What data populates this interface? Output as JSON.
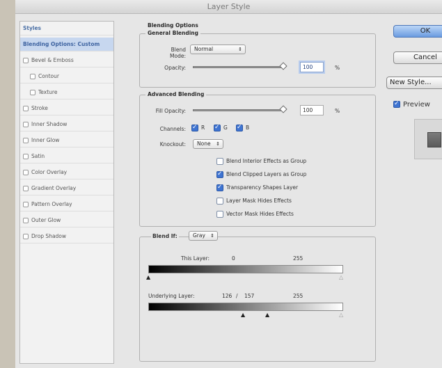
{
  "window": {
    "title": "Layer Style"
  },
  "sidebar": {
    "items": [
      {
        "label": "Styles",
        "type": "header"
      },
      {
        "label": "Blending Options: Custom",
        "type": "active"
      },
      {
        "label": "Bevel & Emboss",
        "type": "check"
      },
      {
        "label": "Contour",
        "type": "subcheck"
      },
      {
        "label": "Texture",
        "type": "subcheck"
      },
      {
        "label": "Stroke",
        "type": "check"
      },
      {
        "label": "Inner Shadow",
        "type": "check"
      },
      {
        "label": "Inner Glow",
        "type": "check"
      },
      {
        "label": "Satin",
        "type": "check"
      },
      {
        "label": "Color Overlay",
        "type": "check"
      },
      {
        "label": "Gradient Overlay",
        "type": "check"
      },
      {
        "label": "Pattern Overlay",
        "type": "check"
      },
      {
        "label": "Outer Glow",
        "type": "check"
      },
      {
        "label": "Drop Shadow",
        "type": "check"
      }
    ]
  },
  "blending": {
    "section_title": "Blending Options",
    "general": {
      "title": "General Blending",
      "blend_mode_label": "Blend Mode:",
      "blend_mode_value": "Normal",
      "opacity_label": "Opacity:",
      "opacity_value": "100",
      "opacity_unit": "%",
      "opacity_level": 1.0
    },
    "advanced": {
      "title": "Advanced Blending",
      "fill_opacity_label": "Fill Opacity:",
      "fill_opacity_value": "100",
      "fill_opacity_unit": "%",
      "fill_opacity_level": 1.0,
      "channels_label": "Channels:",
      "channels": [
        {
          "label": "R",
          "checked": true
        },
        {
          "label": "G",
          "checked": true
        },
        {
          "label": "B",
          "checked": true
        }
      ],
      "knockout_label": "Knockout:",
      "knockout_value": "None",
      "options": [
        {
          "label": "Blend Interior Effects as Group",
          "checked": false
        },
        {
          "label": "Blend Clipped Layers as Group",
          "checked": true
        },
        {
          "label": "Transparency Shapes Layer",
          "checked": true
        },
        {
          "label": "Layer Mask Hides Effects",
          "checked": false
        },
        {
          "label": "Vector Mask Hides Effects",
          "checked": false
        }
      ]
    },
    "blend_if": {
      "label": "Blend If:",
      "value": "Gray",
      "this_layer_label": "This Layer:",
      "this_layer_low": "0",
      "this_layer_high": "255",
      "underlying_label": "Underlying Layer:",
      "underlying_low": "126",
      "underlying_sep": "/",
      "underlying_low2": "157",
      "underlying_high": "255"
    }
  },
  "buttons": {
    "ok": "OK",
    "cancel": "Cancel",
    "new_style": "New Style...",
    "preview_label": "Preview",
    "preview_checked": true
  }
}
